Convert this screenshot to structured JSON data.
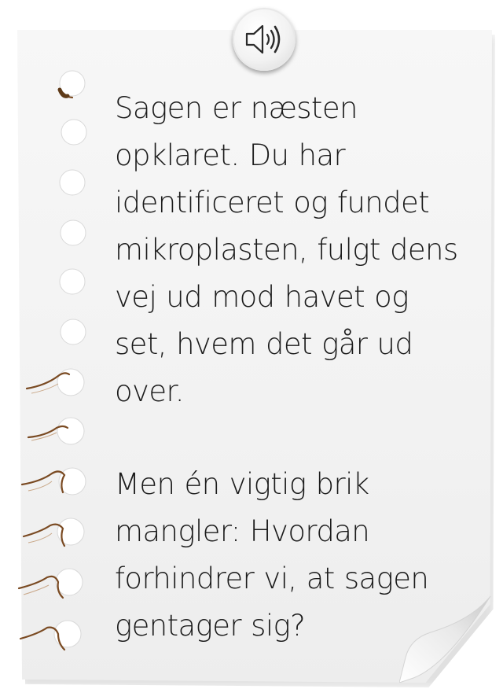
{
  "note": {
    "paragraph_1": "Sagen er næsten opklaret. Du har identificeret og fundet mikroplasten, fulgt dens vej ud mod havet og set, hvem det går ud over.",
    "paragraph_2": "Men én vigtig brik mangler: Hvordan forhindrer vi, at sagen gentager sig?"
  },
  "icons": {
    "speaker": "speaker-icon"
  },
  "colors": {
    "paper": "#f4f4f4",
    "text": "#1b1b1b",
    "binding_edge": "#8b5a2b"
  }
}
